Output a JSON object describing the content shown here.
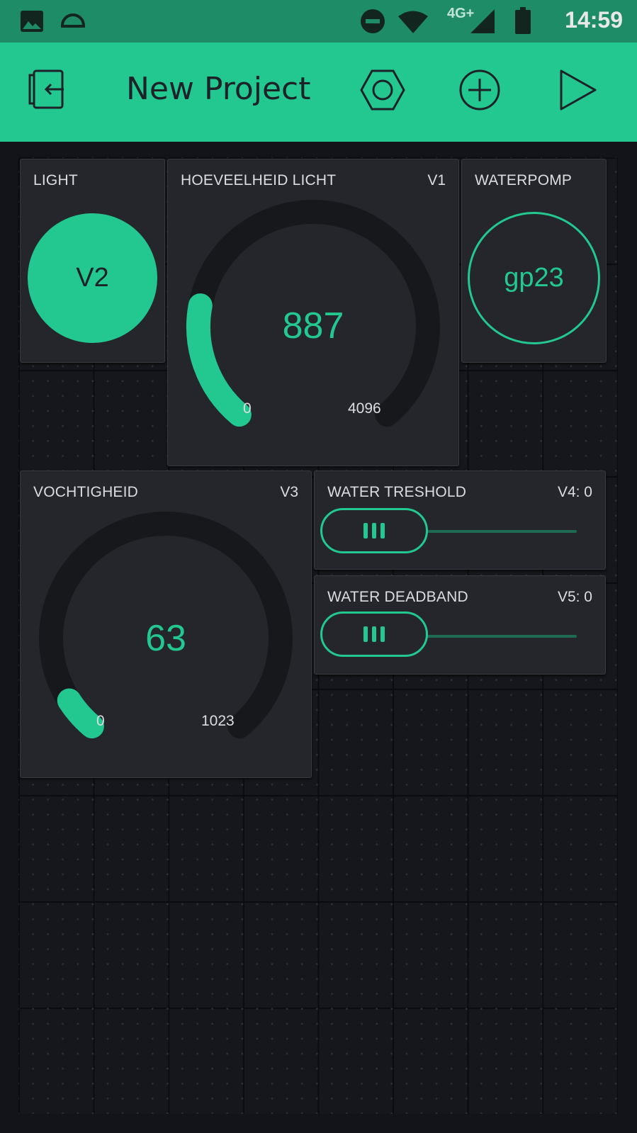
{
  "status_bar": {
    "time": "14:59",
    "network": "4G+",
    "icons": [
      "gallery-icon",
      "notification-icon",
      "do-not-disturb-icon",
      "wifi-icon",
      "signal-icon",
      "battery-icon"
    ]
  },
  "toolbar": {
    "title": "New Project",
    "icons": [
      "exit-icon",
      "settings-hex-icon",
      "add-widget-icon",
      "play-icon"
    ]
  },
  "colors": {
    "accent": "#23c890",
    "toolbar": "#23c890",
    "statusbar": "#1e8c67",
    "widget_bg": "#24262b",
    "background": "#121419"
  },
  "widgets": {
    "light": {
      "label": "LIGHT",
      "button_text": "V2"
    },
    "hoeveelheid": {
      "label": "HOEVEELHEID LICHT",
      "pin": "V1",
      "value": "887",
      "min": "0",
      "max": "4096",
      "fraction": 0.2166
    },
    "waterpomp": {
      "label": "WATERPOMP",
      "button_text": "gp23"
    },
    "vochtigheid": {
      "label": "VOCHTIGHEID",
      "pin": "V3",
      "value": "63",
      "min": "0",
      "max": "1023",
      "fraction": 0.0616
    },
    "water_treshold": {
      "label": "WATER TRESHOLD",
      "pin": "V4: 0",
      "fraction": 0
    },
    "water_deadband": {
      "label": "WATER DEADBAND",
      "pin": "V5: 0",
      "fraction": 0
    }
  }
}
